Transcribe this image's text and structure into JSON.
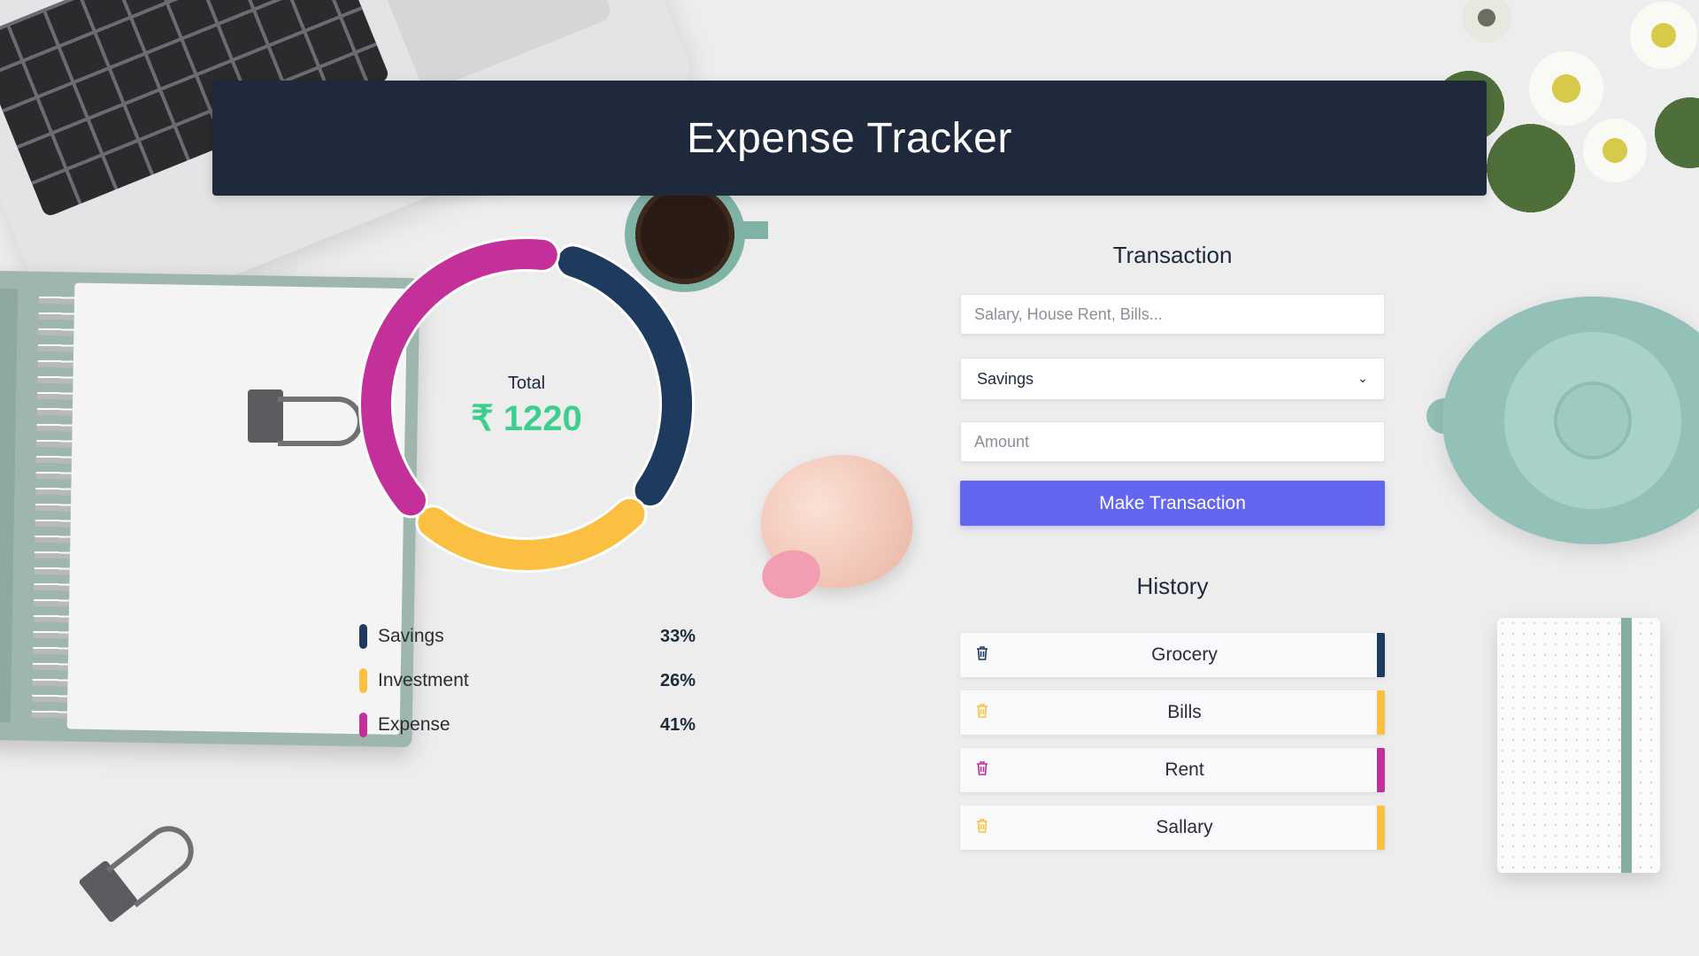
{
  "header": {
    "title": "Expense Tracker"
  },
  "summary": {
    "total_label": "Total",
    "total_value": "₹ 1220"
  },
  "chart_data": {
    "type": "pie",
    "categories": [
      "Savings",
      "Investment",
      "Expense"
    ],
    "values": [
      33,
      26,
      41
    ],
    "colors": [
      "#1e3a5f",
      "#fbbf42",
      "#c3309a"
    ]
  },
  "legend": [
    {
      "label": "Savings",
      "percent": "33%",
      "color": "#1e3a5f"
    },
    {
      "label": "Investment",
      "percent": "26%",
      "color": "#fbbf42"
    },
    {
      "label": "Expense",
      "percent": "41%",
      "color": "#c3309a"
    }
  ],
  "transaction": {
    "title": "Transaction",
    "name_placeholder": "Salary, House Rent, Bills...",
    "type_selected": "Savings",
    "amount_placeholder": "Amount",
    "submit_label": "Make Transaction"
  },
  "history": {
    "title": "History",
    "items": [
      {
        "name": "Grocery",
        "color": "#1e3a5f",
        "icon": "trash-icon"
      },
      {
        "name": "Bills",
        "color": "#fbbf42",
        "icon": "trash-icon"
      },
      {
        "name": "Rent",
        "color": "#c3309a",
        "icon": "trash-icon"
      },
      {
        "name": "Sallary",
        "color": "#fbbf42",
        "icon": "trash-icon"
      }
    ]
  },
  "colors": {
    "header_bg": "#1e293b",
    "accent_button": "#6366f1",
    "total_green": "#3ecf8e"
  }
}
